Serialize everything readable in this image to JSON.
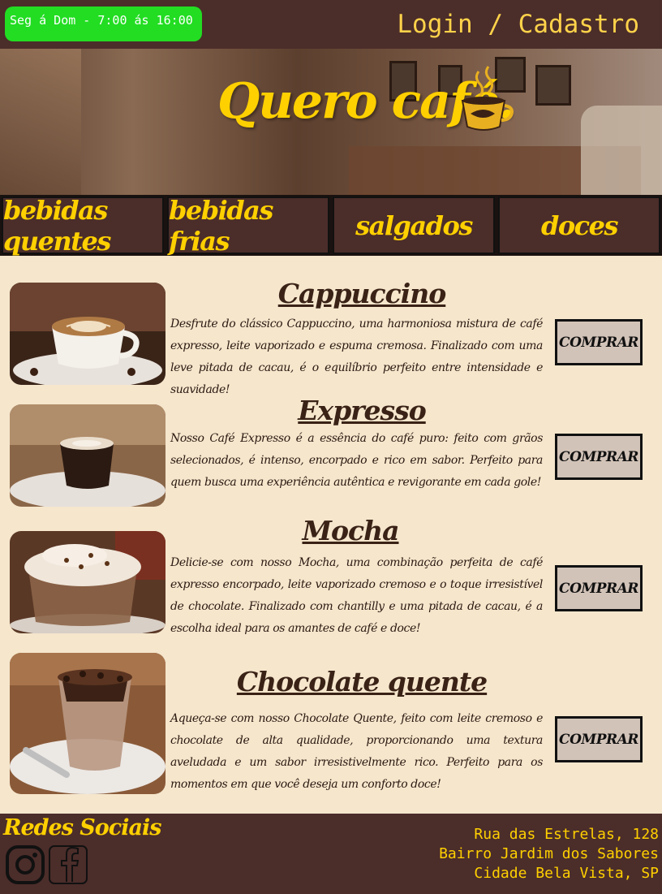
{
  "header": {
    "hours": "Seg á Dom - 7:00 ás 16:00",
    "login_label": "Login / Cadastro"
  },
  "hero": {
    "title": "Quero café.",
    "cup_icon": "coffee-cup-icon",
    "cart_icon": "shopping-cart-icon"
  },
  "nav": {
    "items": [
      {
        "label": "bebidas quentes"
      },
      {
        "label": "bebidas frias"
      },
      {
        "label": "salgados"
      },
      {
        "label": "doces"
      }
    ]
  },
  "products": [
    {
      "name": "Cappuccino",
      "description": "Desfrute do clássico Cappuccino, uma harmoniosa mistura de café expresso, leite vaporizado e espuma cremosa. Finalizado com uma leve pitada de cacau, é o equilíbrio perfeito entre intensidade e suavidade!",
      "buy_label": "COMPRAR"
    },
    {
      "name": "Expresso",
      "description": "Nosso Café Expresso é a essência do café puro: feito com grãos selecionados, é intenso, encorpado e rico em sabor. Perfeito para quem busca uma experiência autêntica e revigorante em cada gole!",
      "buy_label": "COMPRAR"
    },
    {
      "name": "Mocha",
      "description": "Delicie-se com nosso Mocha, uma combinação perfeita de café expresso encorpado, leite vaporizado cremoso e o toque irresistível de chocolate. Finalizado com chantilly e uma pitada de cacau, é a escolha ideal para os amantes de café e doce!",
      "buy_label": "COMPRAR"
    },
    {
      "name": "Chocolate quente",
      "description": "Aqueça-se com nosso Chocolate Quente, feito com leite cremoso e chocolate de alta qualidade, proporcionando uma textura aveludada e um sabor irresistivelmente rico. Perfeito para os momentos em que você deseja um conforto doce!",
      "buy_label": "COMPRAR"
    }
  ],
  "footer": {
    "social_title": "Redes Sociais",
    "social_icons": [
      "instagram-icon",
      "facebook-icon"
    ],
    "address": [
      "Rua das Estrelas, 128",
      "Bairro Jardim dos Sabores",
      "Cidade Bela Vista, SP"
    ]
  },
  "colors": {
    "brown": "#4b2d2a",
    "yellow": "#ffd000",
    "cream": "#f5e6cc",
    "green": "#22dd22"
  }
}
